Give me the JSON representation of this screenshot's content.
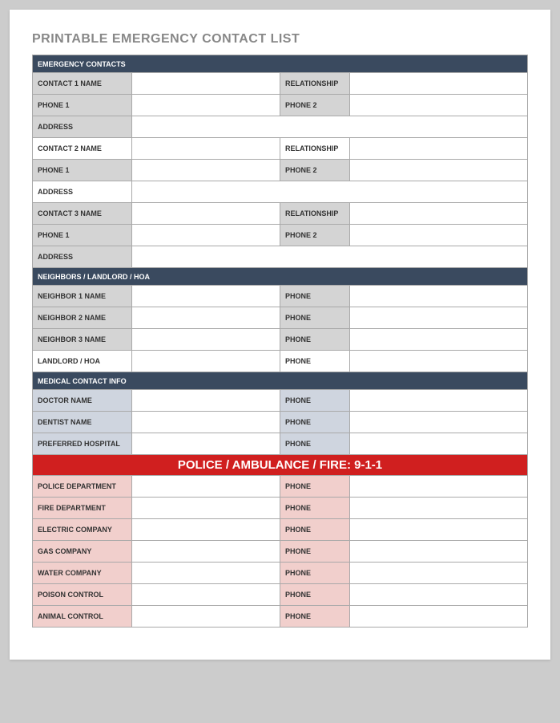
{
  "title": "PRINTABLE EMERGENCY CONTACT LIST",
  "sections": {
    "emergency": {
      "header": "EMERGENCY CONTACTS",
      "contacts": [
        {
          "name_lbl": "CONTACT 1 NAME",
          "rel_lbl": "RELATIONSHIP",
          "p1_lbl": "PHONE 1",
          "p2_lbl": "PHONE 2",
          "addr_lbl": "ADDRESS"
        },
        {
          "name_lbl": "CONTACT 2 NAME",
          "rel_lbl": "RELATIONSHIP",
          "p1_lbl": "PHONE 1",
          "p2_lbl": "PHONE 2",
          "addr_lbl": "ADDRESS"
        },
        {
          "name_lbl": "CONTACT 3 NAME",
          "rel_lbl": "RELATIONSHIP",
          "p1_lbl": "PHONE 1",
          "p2_lbl": "PHONE 2",
          "addr_lbl": "ADDRESS"
        }
      ]
    },
    "neighbors": {
      "header": "NEIGHBORS / LANDLORD / HOA",
      "rows": [
        {
          "name_lbl": "NEIGHBOR 1 NAME",
          "phone_lbl": "PHONE"
        },
        {
          "name_lbl": "NEIGHBOR 2 NAME",
          "phone_lbl": "PHONE"
        },
        {
          "name_lbl": "NEIGHBOR 3 NAME",
          "phone_lbl": "PHONE"
        },
        {
          "name_lbl": "LANDLORD / HOA",
          "phone_lbl": "PHONE"
        }
      ]
    },
    "medical": {
      "header": "MEDICAL CONTACT INFO",
      "rows": [
        {
          "name_lbl": "DOCTOR NAME",
          "phone_lbl": "PHONE"
        },
        {
          "name_lbl": "DENTIST NAME",
          "phone_lbl": "PHONE"
        },
        {
          "name_lbl": "PREFERRED HOSPITAL",
          "phone_lbl": "PHONE"
        }
      ]
    },
    "police": {
      "header": "POLICE / AMBULANCE / FIRE:  9-1-1",
      "rows": [
        {
          "name_lbl": "POLICE DEPARTMENT",
          "phone_lbl": "PHONE"
        },
        {
          "name_lbl": "FIRE DEPARTMENT",
          "phone_lbl": "PHONE"
        },
        {
          "name_lbl": "ELECTRIC COMPANY",
          "phone_lbl": "PHONE"
        },
        {
          "name_lbl": "GAS COMPANY",
          "phone_lbl": "PHONE"
        },
        {
          "name_lbl": "WATER COMPANY",
          "phone_lbl": "PHONE"
        },
        {
          "name_lbl": "POISON CONTROL",
          "phone_lbl": "PHONE"
        },
        {
          "name_lbl": "ANIMAL CONTROL",
          "phone_lbl": "PHONE"
        }
      ]
    }
  }
}
